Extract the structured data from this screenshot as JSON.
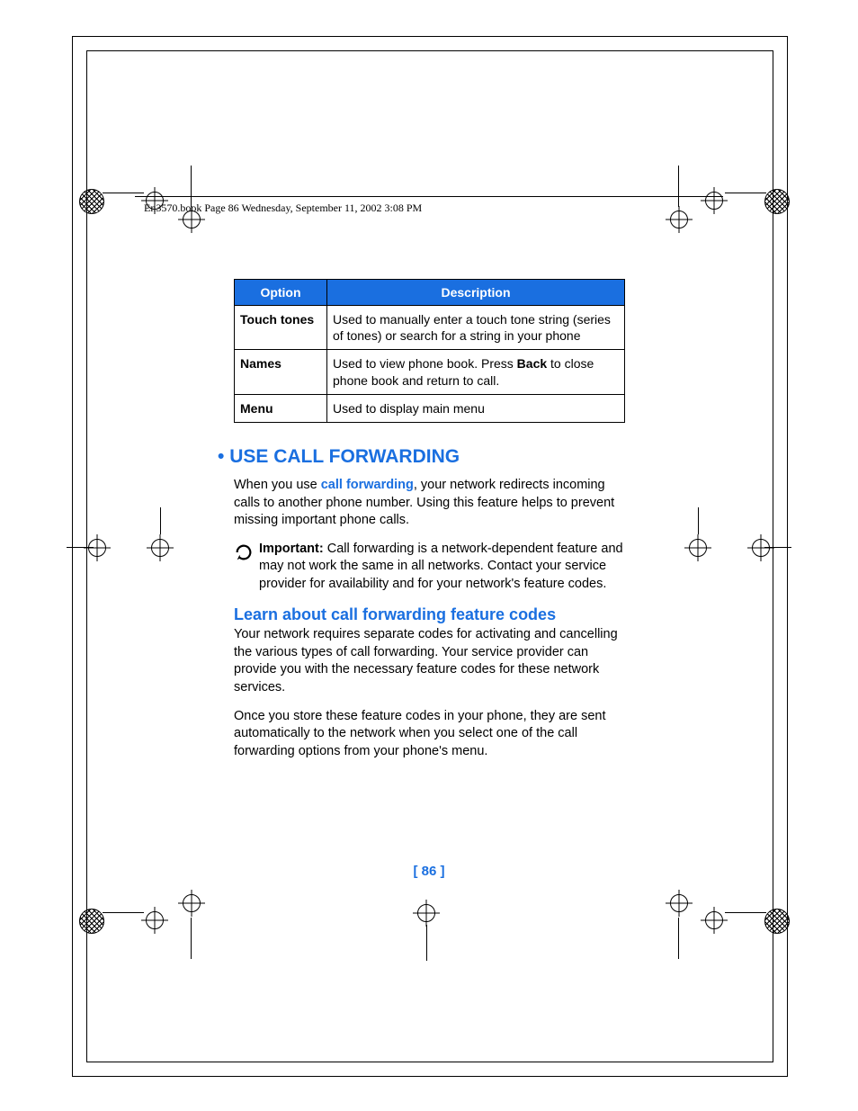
{
  "header": "En3570.book  Page 86  Wednesday, September 11, 2002  3:08 PM",
  "table": {
    "head_option": "Option",
    "head_desc": "Description",
    "rows": [
      {
        "option": "Touch tones",
        "desc": "Used to manually enter a touch tone string (series of tones) or search for a string in your phone"
      },
      {
        "option": "Names",
        "desc_pre": "Used to view phone book. Press ",
        "desc_bold": "Back",
        "desc_post": " to close phone book and return to call."
      },
      {
        "option": "Menu",
        "desc": "Used to display main menu"
      }
    ]
  },
  "section_bullet": "•",
  "section_title": "USE CALL FORWARDING",
  "intro_pre": "When you use ",
  "intro_link": "call forwarding",
  "intro_post": ", your network redirects incoming calls to another phone number. Using this feature helps to prevent missing important phone calls.",
  "note_label": "Important:",
  "note_text": " Call forwarding is a network-dependent feature and may not work the same in all networks. Contact your service provider for availability and for your network's feature codes.",
  "sub_title": "Learn about call forwarding feature codes",
  "p1": "Your network requires separate codes for activating and cancelling the various types of call forwarding. Your service provider can provide you with the necessary feature codes for these network services.",
  "p2": "Once you store these feature codes in your phone, they are sent automatically to the network when you select one of the call forwarding options from your phone's menu.",
  "page_num": "[ 86 ]"
}
